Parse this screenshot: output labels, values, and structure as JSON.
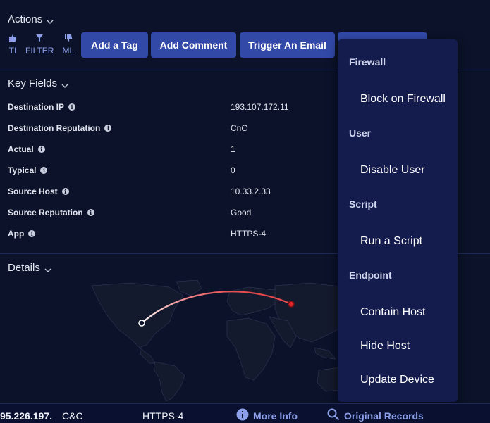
{
  "actions": {
    "title": "Actions",
    "tools": [
      {
        "icon": "thumbs-up-icon",
        "label": "TI"
      },
      {
        "icon": "filter-icon",
        "label": "FILTER"
      },
      {
        "icon": "thumbs-down-icon",
        "label": "ML"
      }
    ],
    "buttons": {
      "add_tag": "Add a Tag",
      "add_comment": "Add Comment",
      "trigger_email": "Trigger An Email"
    }
  },
  "key_fields": {
    "title": "Key Fields",
    "rows": [
      {
        "label": "Destination IP",
        "value": "193.107.172.11"
      },
      {
        "label": "Destination Reputation",
        "value": "CnC"
      },
      {
        "label": "Actual",
        "value": "1"
      },
      {
        "label": "Typical",
        "value": "0"
      },
      {
        "label": "Source Host",
        "value": "10.33.2.33"
      },
      {
        "label": "Source Reputation",
        "value": "Good"
      },
      {
        "label": "App",
        "value": "HTTPS-4"
      }
    ]
  },
  "details": {
    "title": "Details"
  },
  "dropdown": {
    "groups": [
      {
        "name": "Firewall",
        "items": [
          "Block on Firewall"
        ]
      },
      {
        "name": "User",
        "items": [
          "Disable User"
        ]
      },
      {
        "name": "Script",
        "items": [
          "Run a Script"
        ]
      },
      {
        "name": "Endpoint",
        "items": [
          "Contain Host",
          "Hide Host",
          "Update Device"
        ]
      }
    ]
  },
  "bottom_bar": {
    "ip": "95.226.197.",
    "category": "C&C",
    "app": "HTTPS-4",
    "more_info": "More Info",
    "original_records": "Original Records"
  },
  "colors": {
    "background": "#0b1229",
    "button": "#3249a8",
    "menu": "#141c4e",
    "accent_link": "#8c9fe8",
    "arc_red": "#e0262c"
  }
}
